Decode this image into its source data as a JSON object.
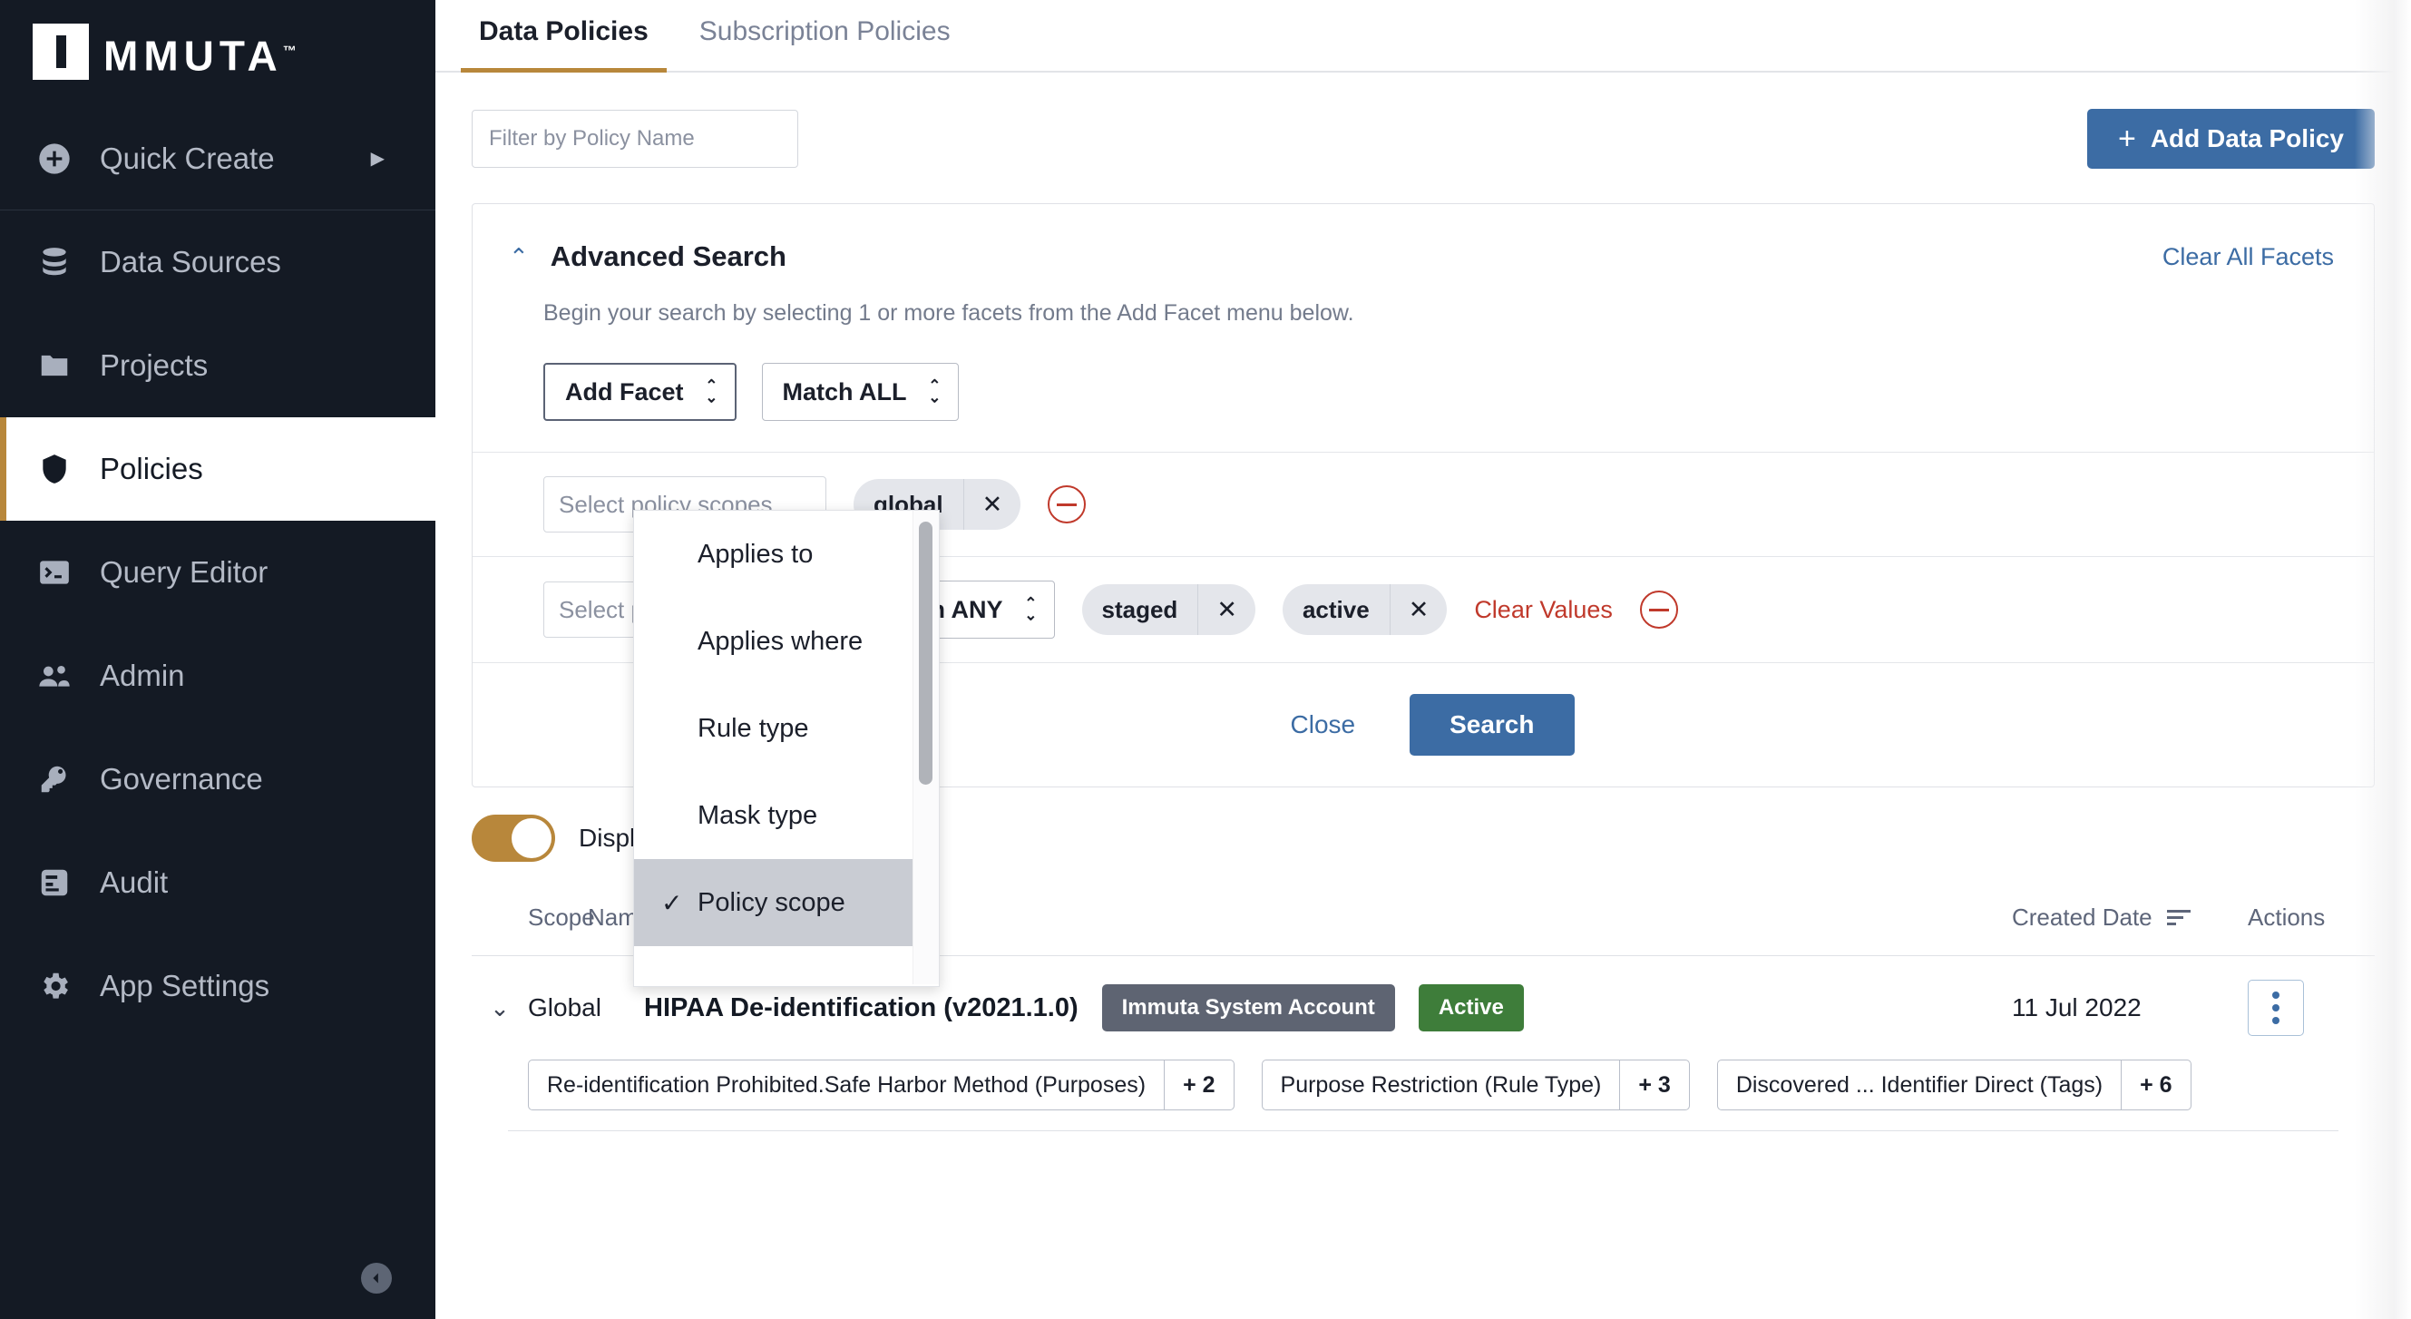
{
  "sidebar": {
    "logo": {
      "text": "MMUTA",
      "tm": "™"
    },
    "items": [
      {
        "label": "Quick Create",
        "icon": "plus-circle-icon",
        "has_chevron": true,
        "active": false
      },
      {
        "label": "Data Sources",
        "icon": "database-icon",
        "has_chevron": false,
        "active": false
      },
      {
        "label": "Projects",
        "icon": "folder-icon",
        "has_chevron": false,
        "active": false
      },
      {
        "label": "Policies",
        "icon": "shield-icon",
        "has_chevron": false,
        "active": true
      },
      {
        "label": "Query Editor",
        "icon": "terminal-icon",
        "has_chevron": false,
        "active": false
      },
      {
        "label": "Admin",
        "icon": "people-icon",
        "has_chevron": false,
        "active": false
      },
      {
        "label": "Governance",
        "icon": "key-icon",
        "has_chevron": false,
        "active": false
      },
      {
        "label": "Audit",
        "icon": "report-icon",
        "has_chevron": false,
        "active": false
      },
      {
        "label": "App Settings",
        "icon": "gear-icon",
        "has_chevron": false,
        "active": false
      }
    ],
    "collapse_icon": "collapse-left-icon"
  },
  "tabs": [
    {
      "label": "Data Policies",
      "active": true
    },
    {
      "label": "Subscription Policies",
      "active": false
    }
  ],
  "toolbar": {
    "filter_placeholder": "Filter by Policy Name",
    "filter_value": "",
    "add_policy_label": "Add Data Policy",
    "add_policy_plus": "+"
  },
  "advanced_search": {
    "title": "Advanced Search",
    "collapse_caret": "⌃",
    "clear_all_label": "Clear All Facets",
    "description": "Begin your search by selecting 1 or more facets from the Add Facet menu below.",
    "add_facet_label": "Add Facet",
    "match_all_label": "Match ALL",
    "close_label": "Close",
    "search_label": "Search",
    "facet_rows": [
      {
        "input_placeholder": "Select policy scopes",
        "match_label": "",
        "chips": [
          {
            "label": "global",
            "remove": "✕"
          }
        ],
        "clear_values_label": "",
        "remove_icon": "remove-facet-icon"
      },
      {
        "input_placeholder": "Select policy states",
        "match_label": "Match ANY",
        "chips": [
          {
            "label": "staged",
            "remove": "✕"
          },
          {
            "label": "active",
            "remove": "✕"
          }
        ],
        "clear_values_label": "Clear Values",
        "remove_icon": "remove-facet-icon"
      }
    ]
  },
  "facet_dropdown": {
    "items": [
      {
        "label": "Applies to",
        "selected": false
      },
      {
        "label": "Applies where",
        "selected": false
      },
      {
        "label": "Rule type",
        "selected": false
      },
      {
        "label": "Mask type",
        "selected": false
      },
      {
        "label": "Policy scope",
        "selected": true
      }
    ],
    "check_glyph": "✓"
  },
  "detail_toggle": {
    "label": "Display Detail Labels",
    "on": true,
    "color": "#b8873b"
  },
  "table": {
    "headers": {
      "scope": "Scope",
      "name": "Name",
      "created_date": "Created Date",
      "actions": "Actions"
    },
    "rows": [
      {
        "expand_caret": "⌄",
        "scope": "Global",
        "name": "HIPAA De-identification (v2021.1.0)",
        "account_badge": "Immuta System Account",
        "state_badge": "Active",
        "created_date": "11 Jul 2022",
        "actions_icon": "kebab-menu-icon",
        "tags": [
          {
            "label": "Re-identification Prohibited.Safe Harbor Method (Purposes)",
            "count": "+ 2"
          },
          {
            "label": "Purpose Restriction (Rule Type)",
            "count": "+ 3"
          },
          {
            "label": "Discovered ... Identifier Direct (Tags)",
            "count": "+ 6"
          }
        ]
      }
    ]
  },
  "colors": {
    "sidebar_bg": "#141a24",
    "accent_gold": "#b8873b",
    "primary_blue": "#3c6ca4",
    "danger_red": "#c0392b",
    "active_green": "#3e7d3a",
    "account_gray": "#5e6472"
  }
}
